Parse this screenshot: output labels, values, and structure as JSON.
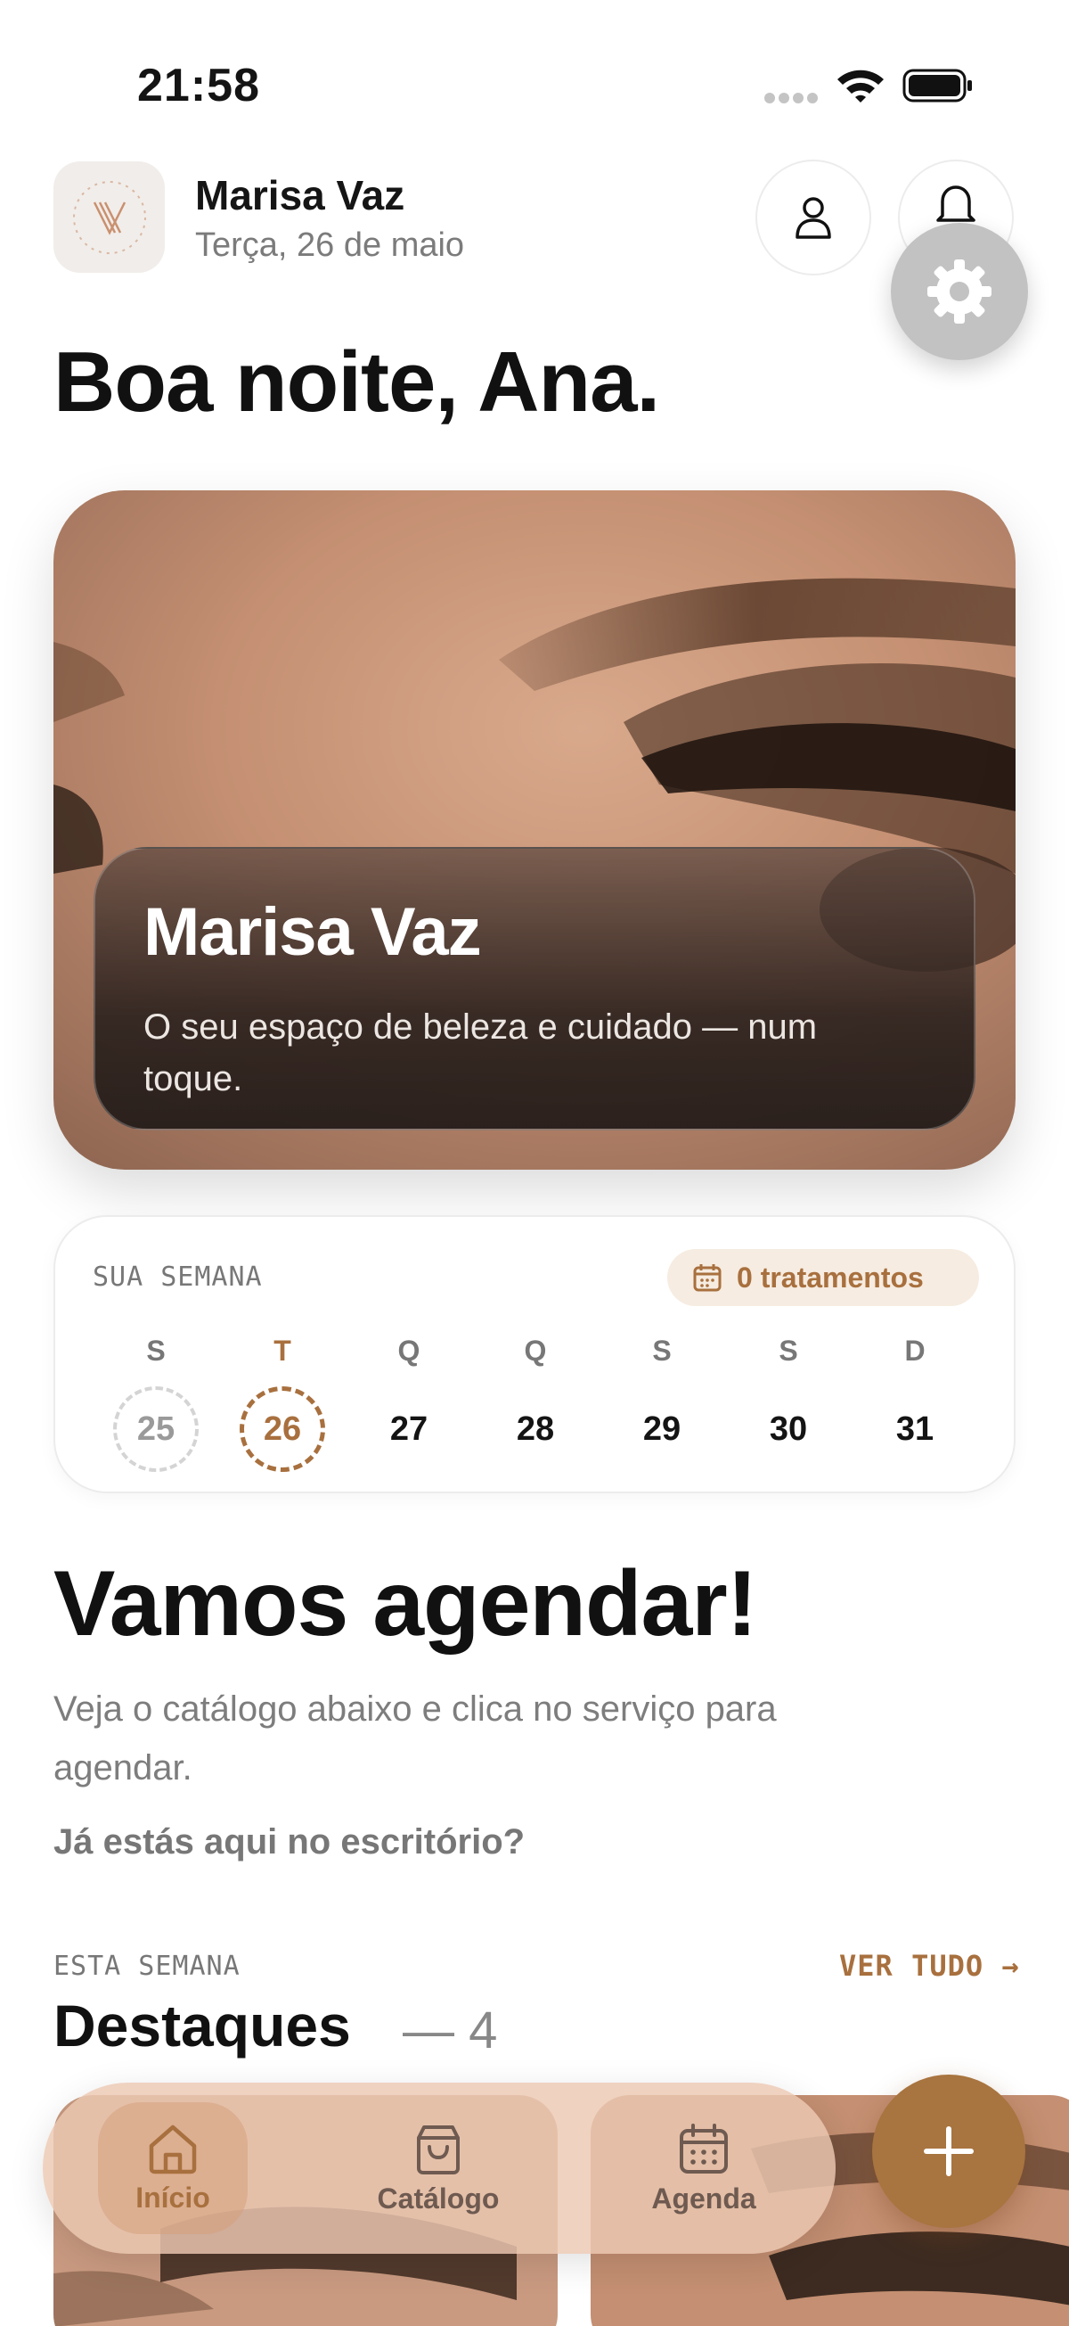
{
  "status_bar": {
    "time": "21:58"
  },
  "header": {
    "brand_name": "Marisa Vaz",
    "date": "Terça, 26 de maio"
  },
  "greeting": "Boa noite, Ana.",
  "hero": {
    "title": "Marisa Vaz",
    "subtitle": "O seu espaço de beleza e cuidado — num toque."
  },
  "week": {
    "label": "SUA SEMANA",
    "badge": "0 tratamentos",
    "days": [
      {
        "letter": "S",
        "number": "25"
      },
      {
        "letter": "T",
        "number": "26"
      },
      {
        "letter": "Q",
        "number": "27"
      },
      {
        "letter": "Q",
        "number": "28"
      },
      {
        "letter": "S",
        "number": "29"
      },
      {
        "letter": "S",
        "number": "30"
      },
      {
        "letter": "D",
        "number": "31"
      }
    ]
  },
  "schedule": {
    "title": "Vamos agendar!",
    "text": "Veja o catálogo abaixo e clica no serviço para agendar.",
    "question": "Já estás aqui no escritório?"
  },
  "highlights": {
    "section_label": "ESTA SEMANA",
    "see_all": "VER TUDO →",
    "title": "Destaques",
    "count": "— 4"
  },
  "nav": {
    "home": "Início",
    "catalog": "Catálogo",
    "agenda": "Agenda"
  },
  "colors": {
    "accent": "#a8703e",
    "fab": "#a8743f",
    "nav_bg": "#ecc8b2"
  }
}
